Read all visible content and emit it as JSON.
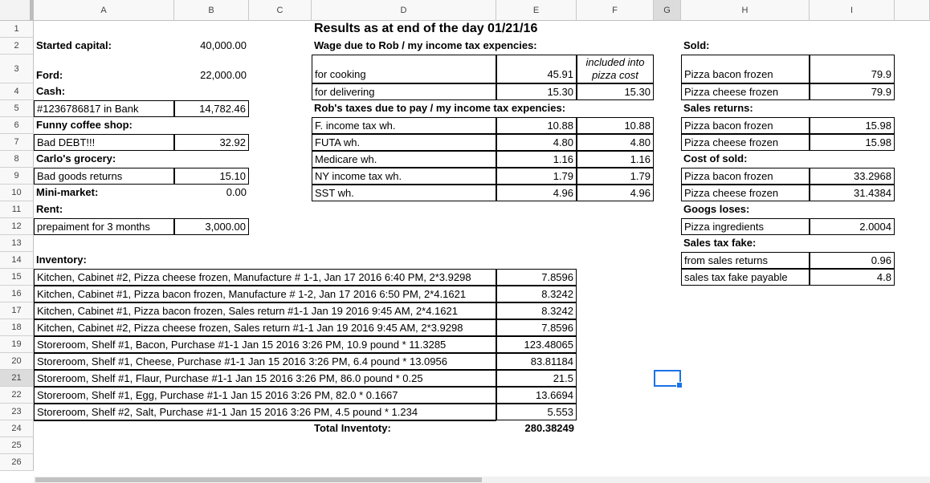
{
  "columns": [
    "A",
    "B",
    "C",
    "D",
    "E",
    "F",
    "G",
    "H",
    "I"
  ],
  "selected_column": "G",
  "rows": [
    "1",
    "2",
    "3",
    "4",
    "5",
    "6",
    "7",
    "8",
    "9",
    "10",
    "11",
    "12",
    "13",
    "14",
    "15",
    "16",
    "17",
    "18",
    "19",
    "20",
    "21",
    "22",
    "23",
    "24",
    "25",
    "26"
  ],
  "selected_row": "21",
  "title": "Results as at end of the day 01/21/16",
  "left": {
    "started_capital_label": "Started capital:",
    "started_capital_value": "40,000.00",
    "ford_label": "Ford:",
    "ford_value": "22,000.00",
    "cash_label": "Cash:",
    "bank_label": "#1236786817 in Bank",
    "bank_value": "14,782.46",
    "funny_label": "Funny coffee shop:",
    "bad_debt_label": "Bad DEBT!!!",
    "bad_debt_value": "32.92",
    "carlo_label": "Carlo's grocery:",
    "bad_goods_label": "Bad goods returns",
    "bad_goods_value": "15.10",
    "minimarket_label": "Mini-market:",
    "minimarket_value": "0.00",
    "rent_label": "Rent:",
    "prepaid_label": "prepaiment for 3 months",
    "prepaid_value": "3,000.00"
  },
  "wage": {
    "header": "Wage due to Rob / my income tax expencies:",
    "included_note_1": "included into",
    "included_note_2": "pizza cost",
    "rows": [
      {
        "label": "for cooking",
        "e": "45.91",
        "f": ""
      },
      {
        "label": "for delivering",
        "e": "15.30",
        "f": "15.30"
      }
    ]
  },
  "taxes": {
    "header": "Rob's taxes due to pay / my income tax expencies:",
    "rows": [
      {
        "label": "F. income tax wh.",
        "e": "10.88",
        "f": "10.88"
      },
      {
        "label": "FUTA wh.",
        "e": "4.80",
        "f": "4.80"
      },
      {
        "label": "Medicare wh.",
        "e": "1.16",
        "f": "1.16"
      },
      {
        "label": "NY income tax wh.",
        "e": "1.79",
        "f": "1.79"
      },
      {
        "label": "SST wh.",
        "e": "4.96",
        "f": "4.96"
      }
    ]
  },
  "right": {
    "sold_label": "Sold:",
    "sold_rows": [
      {
        "label": "Pizza bacon frozen",
        "value": "79.9"
      },
      {
        "label": "Pizza cheese frozen",
        "value": "79.9"
      }
    ],
    "returns_label": "Sales returns:",
    "returns_rows": [
      {
        "label": "Pizza bacon frozen",
        "value": "15.98"
      },
      {
        "label": "Pizza cheese frozen",
        "value": "15.98"
      }
    ],
    "cost_label": "Cost of sold:",
    "cost_rows": [
      {
        "label": "Pizza bacon frozen",
        "value": "33.2968"
      },
      {
        "label": "Pizza cheese frozen",
        "value": "31.4384"
      }
    ],
    "loses_label": "Googs loses:",
    "loses_rows": [
      {
        "label": "Pizza ingredients",
        "value": "2.0004"
      }
    ],
    "fake_label": "Sales tax fake:",
    "fake_rows": [
      {
        "label": "from sales returns",
        "value": "0.96"
      },
      {
        "label": "sales tax fake payable",
        "value": "4.8"
      }
    ]
  },
  "inventory": {
    "label": "Inventory:",
    "rows": [
      {
        "label": "Kitchen, Cabinet #2, Pizza cheese frozen, Manufacture # 1-1, Jan 17 2016 6:40 PM, 2*3.9298",
        "value": "7.8596"
      },
      {
        "label": "Kitchen, Cabinet #1, Pizza bacon frozen, Manufacture # 1-2, Jan 17 2016 6:50 PM, 2*4.1621",
        "value": "8.3242"
      },
      {
        "label": "Kitchen, Cabinet #1, Pizza bacon frozen, Sales return #1-1 Jan 19 2016 9:45 AM, 2*4.1621",
        "value": "8.3242"
      },
      {
        "label": "Kitchen, Cabinet #2, Pizza cheese frozen, Sales return #1-1 Jan 19 2016 9:45 AM, 2*3.9298",
        "value": "7.8596"
      },
      {
        "label": "Storeroom, Shelf #1, Bacon, Purchase #1-1 Jan 15 2016 3:26 PM, 10.9 pound * 11.3285",
        "value": "123.48065"
      },
      {
        "label": "Storeroom, Shelf #1, Cheese, Purchase #1-1 Jan 15 2016 3:26 PM, 6.4 pound * 13.0956",
        "value": "83.81184"
      },
      {
        "label": "Storeroom, Shelf #1, Flaur, Purchase #1-1 Jan 15 2016 3:26 PM, 86.0 pound * 0.25",
        "value": "21.5"
      },
      {
        "label": "Storeroom, Shelf #1, Egg, Purchase #1-1 Jan 15 2016 3:26 PM, 82.0 * 0.1667",
        "value": "13.6694"
      },
      {
        "label": "Storeroom, Shelf #2, Salt, Purchase #1-1 Jan 15 2016 3:26 PM, 4.5 pound * 1.234",
        "value": "5.553"
      }
    ],
    "total_label": "Total Inventoty:",
    "total_value": "280.38249"
  }
}
